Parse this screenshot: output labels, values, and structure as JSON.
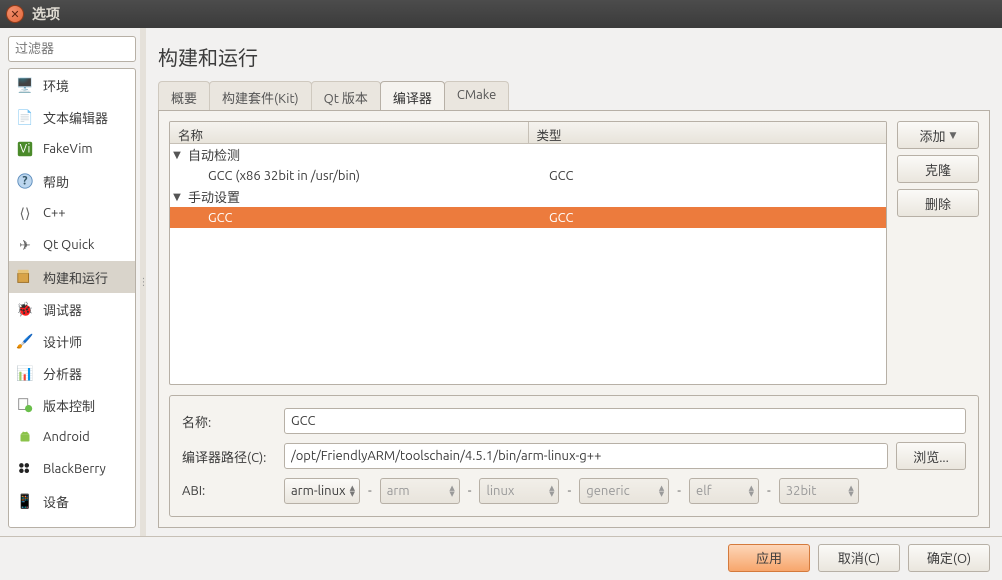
{
  "window": {
    "title": "选项"
  },
  "sidebar": {
    "filter_placeholder": "过滤器",
    "items": [
      {
        "label": "环境"
      },
      {
        "label": "文本编辑器"
      },
      {
        "label": "FakeVim"
      },
      {
        "label": "帮助"
      },
      {
        "label": "C++"
      },
      {
        "label": "Qt Quick"
      },
      {
        "label": "构建和运行"
      },
      {
        "label": "调试器"
      },
      {
        "label": "设计师"
      },
      {
        "label": "分析器"
      },
      {
        "label": "版本控制"
      },
      {
        "label": "Android"
      },
      {
        "label": "BlackBerry"
      },
      {
        "label": "设备"
      }
    ]
  },
  "main": {
    "title": "构建和运行",
    "tabs": [
      {
        "label": "概要"
      },
      {
        "label": "构建套件(Kit)"
      },
      {
        "label": "Qt 版本"
      },
      {
        "label": "编译器"
      },
      {
        "label": "CMake"
      }
    ],
    "tree": {
      "headers": {
        "name": "名称",
        "type": "类型"
      },
      "groups": [
        {
          "label": "自动检测",
          "rows": [
            {
              "name": "GCC (x86 32bit in /usr/bin)",
              "type": "GCC"
            }
          ]
        },
        {
          "label": "手动设置",
          "rows": [
            {
              "name": "GCC",
              "type": "GCC"
            }
          ]
        }
      ]
    },
    "buttons": {
      "add": "添加",
      "clone": "克隆",
      "delete": "删除"
    },
    "detail": {
      "name_label": "名称:",
      "name_value": "GCC",
      "path_label": "编译器路径(C):",
      "path_value": "/opt/FriendlyARM/toolschain/4.5.1/bin/arm-linux-g++",
      "browse": "浏览...",
      "abi_label": "ABI:",
      "abi": {
        "combo": "arm-linux",
        "arch": "arm",
        "os": "linux",
        "flavor": "generic",
        "format": "elf",
        "bits": "32bit"
      }
    }
  },
  "bottom": {
    "apply": "应用",
    "cancel": "取消(C)",
    "ok": "确定(O)"
  }
}
